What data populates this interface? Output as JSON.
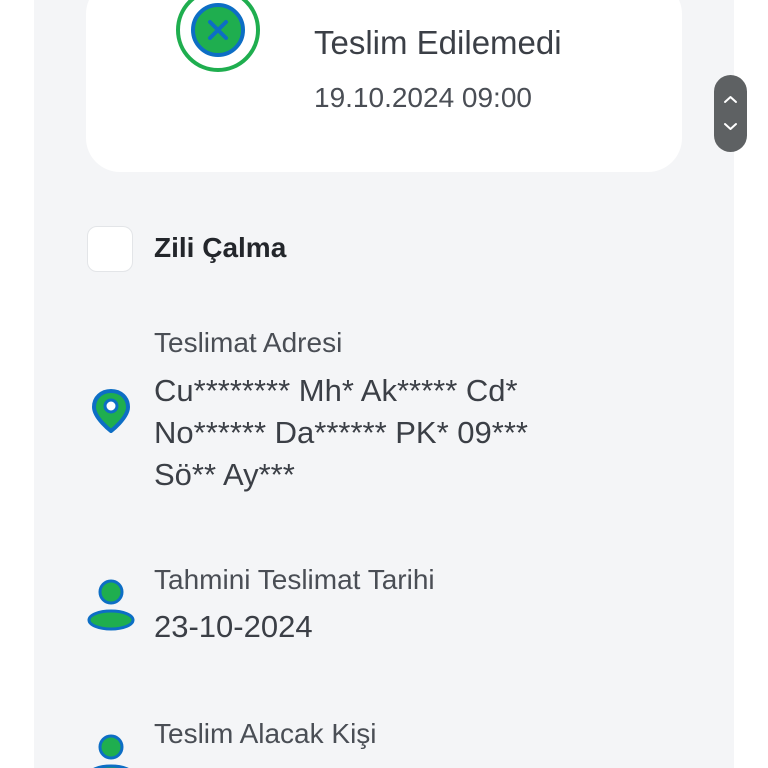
{
  "status": {
    "title": "Teslim Edilemedi",
    "datetime": "19.10.2024 09:00",
    "icon": "failed-x-icon"
  },
  "options": {
    "no_doorbell_label": "Zili Çalma",
    "no_doorbell_checked": false
  },
  "address": {
    "label": "Teslimat Adresi",
    "lines": [
      "Cu******** Mh* Ak***** Cd*",
      "No****** Da****** PK* 09***",
      "Sö** Ay***"
    ],
    "icon": "location-pin-icon"
  },
  "estimated_date": {
    "label": "Tahmini Teslimat Tarihi",
    "value": "23-10-2024",
    "icon": "person-icon"
  },
  "recipient": {
    "label": "Teslim Alacak Kişi",
    "icon": "person-icon"
  },
  "colors": {
    "accent_blue": "#0d6ec5",
    "accent_green": "#1fae4f",
    "panel_bg": "#f4f5f7",
    "scroll_handle": "#5e6163"
  }
}
